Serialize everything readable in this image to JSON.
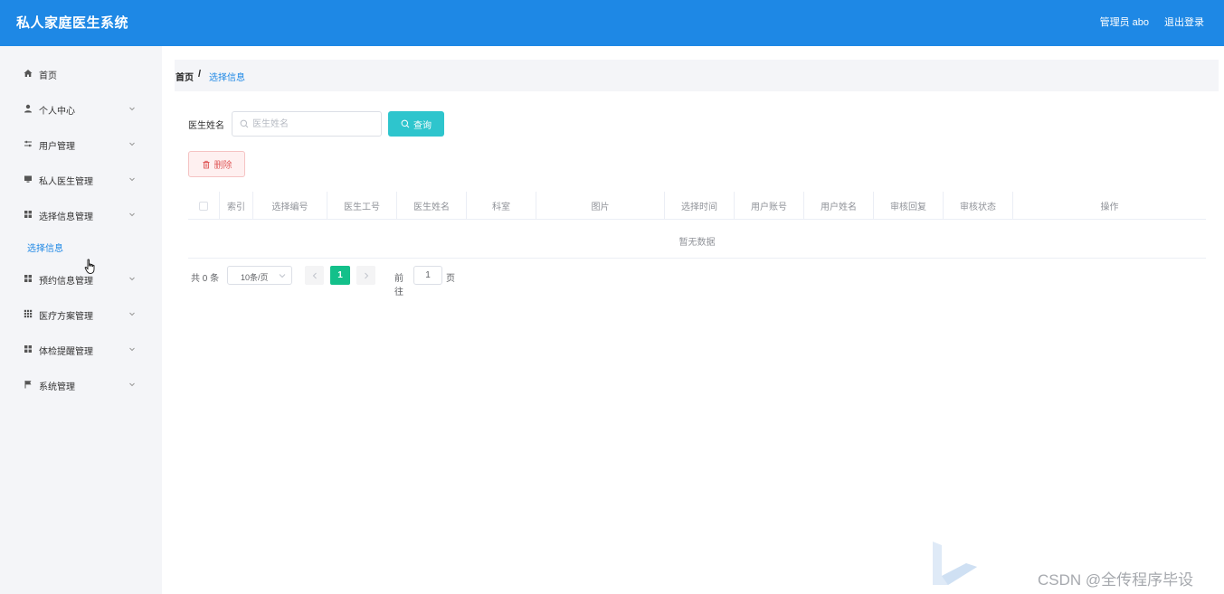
{
  "header": {
    "title": "私人家庭医生系统",
    "user": "管理员 abo",
    "logout": "退出登录",
    "color": "#1e88e5"
  },
  "sidebar": {
    "items": [
      {
        "label": "首页",
        "icon": "home-icon"
      },
      {
        "label": "个人中心",
        "icon": "user-icon",
        "expandable": true
      },
      {
        "label": "用户管理",
        "icon": "sliders-icon",
        "expandable": true
      },
      {
        "label": "私人医生管理",
        "icon": "monitor-icon",
        "expandable": true
      },
      {
        "label": "选择信息管理",
        "icon": "grid-icon",
        "expandable": true,
        "expanded": true,
        "children": [
          {
            "label": "选择信息",
            "active": true
          }
        ]
      },
      {
        "label": "预约信息管理",
        "icon": "grid-icon",
        "expandable": true
      },
      {
        "label": "医疗方案管理",
        "icon": "grid-dots-icon",
        "expandable": true
      },
      {
        "label": "体检提醒管理",
        "icon": "grid-icon",
        "expandable": true
      },
      {
        "label": "系统管理",
        "icon": "flag-icon",
        "expandable": true
      }
    ]
  },
  "breadcrumb": {
    "home": "首页",
    "separator": "/",
    "current": "选择信息"
  },
  "search": {
    "label": "医生姓名",
    "placeholder": "医生姓名",
    "value": "",
    "button": "查询"
  },
  "toolbar": {
    "delete": "删除"
  },
  "table": {
    "columns": [
      "",
      "索引",
      "选择编号",
      "医生工号",
      "医生姓名",
      "科室",
      "图片",
      "选择时间",
      "用户账号",
      "用户姓名",
      "审核回复",
      "审核状态",
      "操作"
    ],
    "rows": [],
    "empty": "暂无数据"
  },
  "pagination": {
    "total": "共 0 条",
    "page_size": "10条/页",
    "current_page": "1",
    "goto_label": "前往",
    "goto_value": "1",
    "goto_unit": "页",
    "active_color": "#13c08a"
  },
  "watermark": "CSDN @全传程序毕设"
}
